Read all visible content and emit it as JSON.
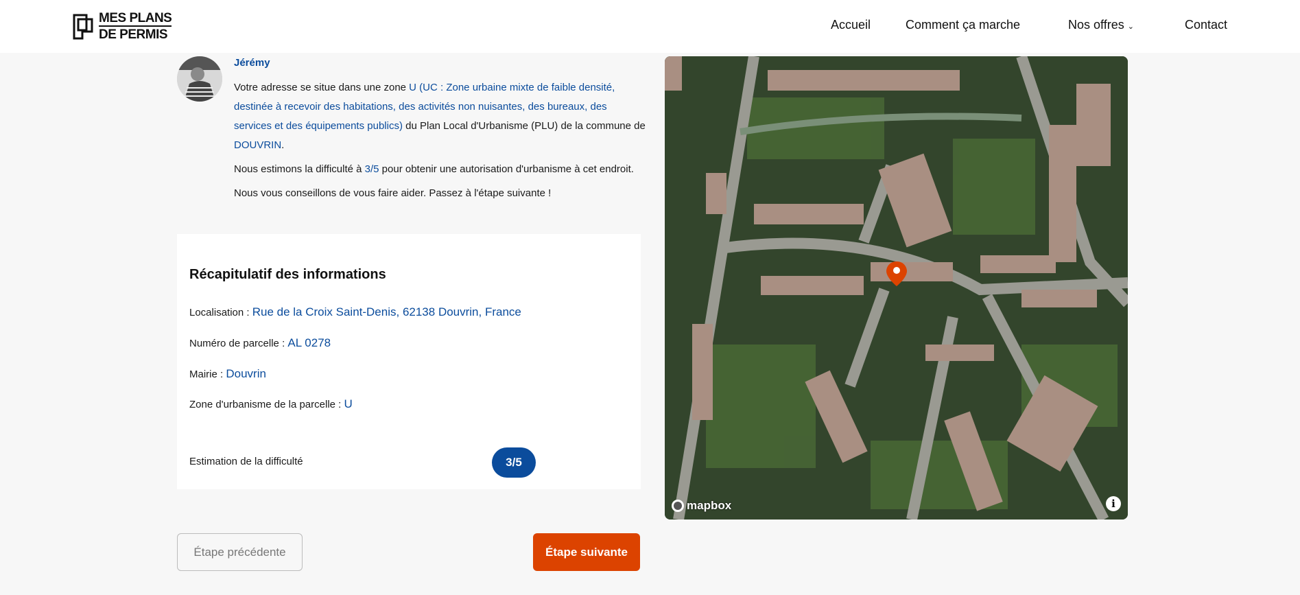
{
  "header": {
    "logo_line1": "MES PLANS",
    "logo_line2": "DE PERMIS",
    "nav": [
      {
        "label": "Accueil"
      },
      {
        "label": "Comment ça marche"
      },
      {
        "label": "Nos offres"
      },
      {
        "label": "Contact"
      }
    ]
  },
  "message": {
    "author": "Jérémy",
    "p1_a": "Votre adresse se situe dans une zone ",
    "p1_zone": "U (UC : Zone urbaine mixte de faible densité, destinée à recevoir des habitations, des activités non nuisantes, des bureaux, des services et des équipements publics)",
    "p1_b": " du Plan Local d'Urbanisme (PLU) de la commune de ",
    "p1_commune": "DOUVRIN",
    "p1_c": ".",
    "p2_a": "Nous estimons la difficulté à ",
    "p2_score": "3/5",
    "p2_b": " pour obtenir une autorisation d'urbanisme à cet endroit.",
    "p3": "Nous vous conseillons de vous faire aider. Passez à l'étape suivante !"
  },
  "summary": {
    "title": "Récapitulatif des informations",
    "rows": [
      {
        "label": "Localisation : ",
        "value": "Rue de la Croix Saint-Denis, 62138 Douvrin, France"
      },
      {
        "label": "Numéro de parcelle : ",
        "value": "AL 0278"
      },
      {
        "label": "Mairie : ",
        "value": "Douvrin"
      },
      {
        "label": "Zone d'urbanisme de la parcelle : ",
        "value": "U"
      }
    ],
    "difficulty_label": "Estimation de la difficulté",
    "difficulty_value": "3/5"
  },
  "buttons": {
    "prev": "Étape précédente",
    "next": "Étape suivante"
  },
  "map": {
    "attribution": "mapbox",
    "info": "i"
  },
  "colors": {
    "accent": "#0b4c9c",
    "cta": "#dc4300"
  }
}
